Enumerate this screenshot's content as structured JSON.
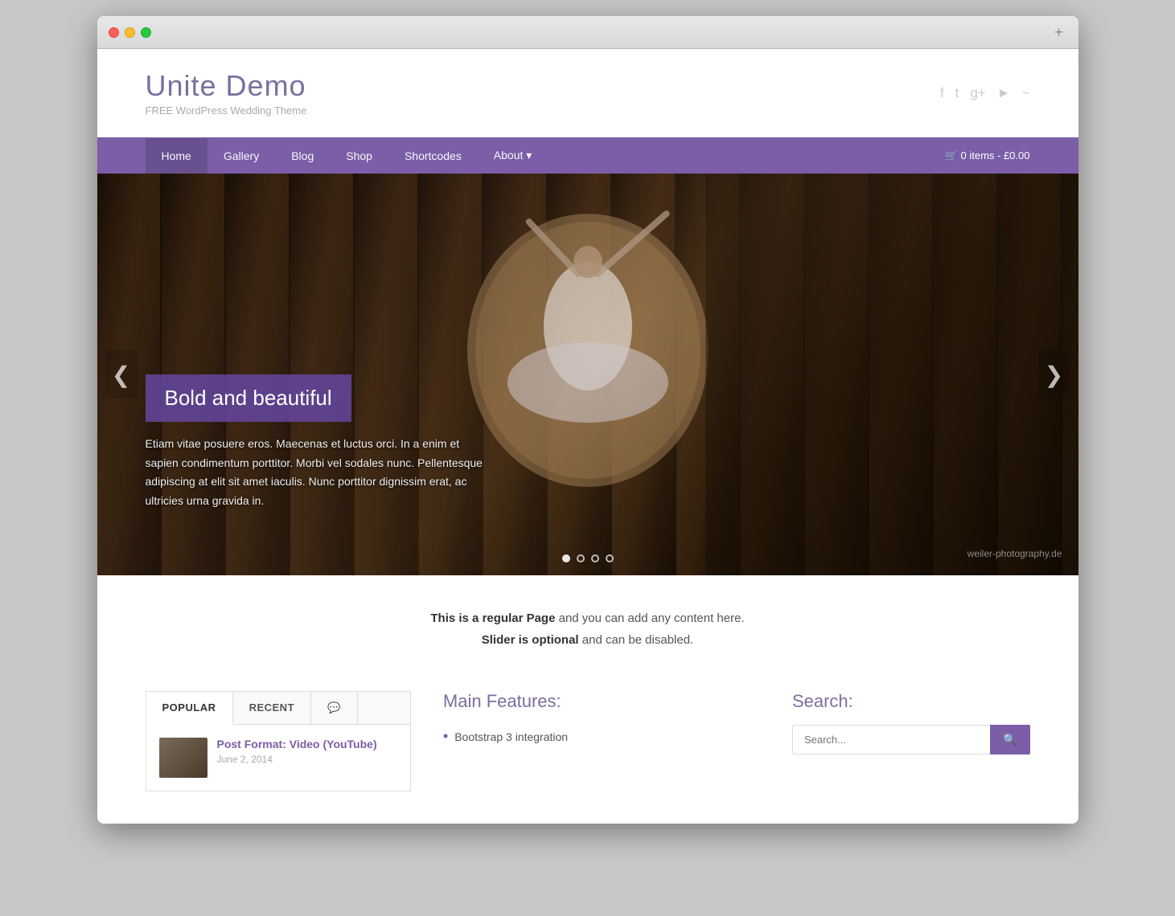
{
  "browser": {
    "add_tab_label": "+"
  },
  "site": {
    "title": "Unite Demo",
    "tagline": "FREE WordPress Wedding Theme"
  },
  "social": {
    "icons": [
      "f",
      "t",
      "g+",
      "▶",
      "~"
    ]
  },
  "nav": {
    "items": [
      {
        "label": "Home",
        "active": true
      },
      {
        "label": "Gallery",
        "active": false
      },
      {
        "label": "Blog",
        "active": false
      },
      {
        "label": "Shop",
        "active": false
      },
      {
        "label": "Shortcodes",
        "active": false
      },
      {
        "label": "About ▾",
        "active": false
      }
    ],
    "cart_label": "🛒 0 items - £0.00"
  },
  "slider": {
    "title": "Bold and beautiful",
    "description": "Etiam vitae posuere eros. Maecenas et luctus orci. In a enim et sapien condimentum porttitor. Morbi vel sodales nunc. Pellentesque adipiscing at elit sit amet iaculis. Nunc porttitor dignissim erat, ac ultricies urna gravida in.",
    "watermark": "weiler-photography.de",
    "prev_label": "❮",
    "next_label": "❯",
    "dots": [
      {
        "active": true
      },
      {
        "active": false
      },
      {
        "active": false
      },
      {
        "active": false
      }
    ]
  },
  "content_intro": {
    "line1_bold": "This is a regular Page",
    "line1_rest": " and you can add any content here.",
    "line2_bold": "Slider is optional",
    "line2_rest": " and can be disabled."
  },
  "tabs": {
    "headers": [
      {
        "label": "POPULAR",
        "active": true
      },
      {
        "label": "RECENT",
        "active": false
      },
      {
        "label": "💬",
        "active": false
      }
    ],
    "post": {
      "title": "Post Format: Video (YouTube)",
      "date": "June 2, 2014"
    }
  },
  "features": {
    "title": "Main Features:",
    "items": [
      "Bootstrap 3 integration"
    ]
  },
  "search": {
    "title": "Search:",
    "placeholder": "Search...",
    "button_label": "🔍"
  }
}
